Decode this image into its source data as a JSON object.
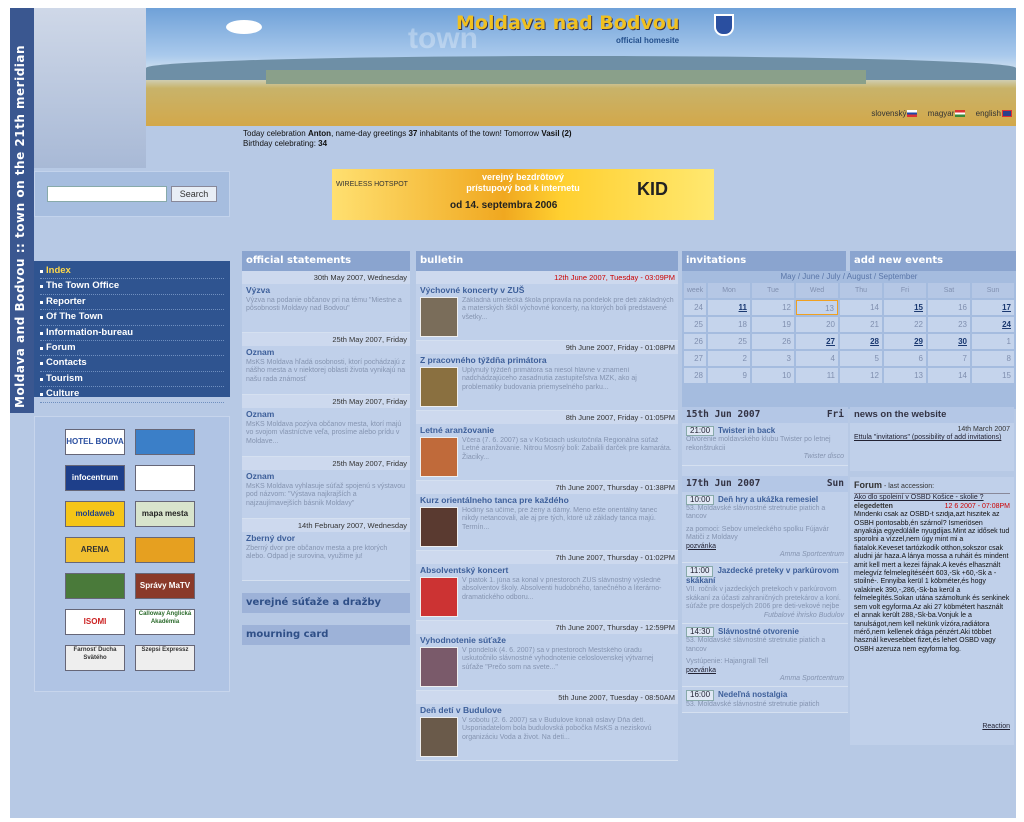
{
  "sidebar": {
    "vertical_title": "Moldava and Bodvou :: town on the 21th meridian",
    "search_button": "Search",
    "nav": [
      "Index",
      "The Town Office",
      "Reporter",
      "Of The Town",
      "Information-bureau",
      "Forum",
      "Contacts",
      "Tourism",
      "Culture"
    ]
  },
  "header": {
    "title": "Moldava nad Bodvou",
    "subtitle": "official homesite",
    "watermark": "town",
    "languages": [
      "slovenský",
      "magyar",
      "english"
    ]
  },
  "celebration": {
    "pre": "Today celebration",
    "name": "Anton",
    "mid": ", name-day greetings",
    "count": "37",
    "post": "inhabitants of the town! Tomorrow",
    "tomorrow": "Vasil (2)",
    "birthday_label": "Birthday celebrating:",
    "birthday_count": "34"
  },
  "ad": {
    "left": "WIRELESS HOTSPOT",
    "line1": "verejný bezdrôtový",
    "line2": "prístupový bod k internetu",
    "date": "od 14. septembra 2006",
    "brand": "KID"
  },
  "logos": [
    "HOTEL BODVA",
    "",
    "infocentrum",
    "",
    "moldaweb",
    "mapa mesta",
    "ARENA",
    "",
    "",
    "Správy MaTV",
    "ISOMI",
    "Calloway Anglická Akadémia",
    "Farnosť Ducha Svätého",
    "Szepsi Expressz"
  ],
  "statements": {
    "heading": "official statements",
    "items": [
      {
        "date": "30th May 2007, Wednesday",
        "title": "Výzva",
        "text": "Výzva na podanie občanov pri na tému \"Miestne a pôsobnosti Moldavy nad Bodvou\""
      },
      {
        "date": "25th May 2007, Friday",
        "title": "Oznam",
        "text": "MsKS Moldava hľadá osobnosti, ktorí pochádzajú z nášho mesta a v niektorej oblasti života vynikajú na našu rada známosť"
      },
      {
        "date": "25th May 2007, Friday",
        "title": "Oznam",
        "text": "MsKS Moldava pozýva občanov mesta, ktorí majú vo svojom vlastníctve veľa, prosíme alebo prídu v Moldave..."
      },
      {
        "date": "25th May 2007, Friday",
        "title": "Oznam",
        "text": "MsKS Moldava vyhlasuje súťaž spojenú s výstavou pod názvom: \"Výstava najkrajších a najzaujímavejších básnik Moldavy\""
      },
      {
        "date": "14th February 2007, Wednesday",
        "title": "Zberný dvor",
        "text": "Zberný dvor pre občanov mesta a pre ktorých alebo. Odpad je surovina, využime ju!"
      }
    ],
    "link1": "verejné súťaže a dražby",
    "link2": "mourning card"
  },
  "bulletin": {
    "heading": "bulletin",
    "items": [
      {
        "date": "12th June 2007, Tuesday - 03:09PM",
        "title": "Výchovné koncerty v ZUŠ",
        "text": "Základná umelecká škola pripravila na pondelok pre deti základných a materských škôl výchovné koncerty, na ktorých boli predstavené všetky..."
      },
      {
        "date": "9th June 2007, Friday - 01:08PM",
        "title": "Z pracovného týždňa primátora",
        "text": "Uplynulý týždeň primátora sa niesol hlavne v znamení nadchádzajúceho zasadnutia zastupiteľstva MZK, ako aj problematiky budovania priemyselného parku..."
      },
      {
        "date": "8th June 2007, Friday - 01:05PM",
        "title": "Letné aranžovanie",
        "text": "Včera (7. 6. 2007) sa v Košiciach uskutočnila Regionálna súťaž Letné aranžovanie. Nitrou Mosný boli: Zabalili darček pre kamaráta. Žiaciky..."
      },
      {
        "date": "7th June 2007, Thursday - 01:38PM",
        "title": "Kurz orientálneho tanca pre každého",
        "text": "Hodiny sa učíme, pre ženy a dámy. Meno ešte orientálny tanec nikdy netancovali, ale aj pre tých, ktoré už základy tanca majú. Termín..."
      },
      {
        "date": "7th June 2007, Thursday - 01:02PM",
        "title": "Absolventský koncert",
        "text": "V piatok 1. júna sa konal v priestoroch ZUŠ slávnostný výsledné absolventov školy. Absolventi hudobného, tanečného a literárno-dramatického odboru..."
      },
      {
        "date": "7th June 2007, Thursday - 12:59PM",
        "title": "Vyhodnotenie súťaže",
        "text": "V pondelok (4. 6. 2007) sa v priestoroch Mestského úradu uskutočnilo slávnostné vyhodnotenie celoslovenskej výtvarnej súťaže \"Prečo som na svete...\""
      },
      {
        "date": "5th June 2007, Tuesday - 08:50AM",
        "title": "Deň detí v Budulove",
        "text": "V sobotu (2. 6. 2007) sa v Budulove konali oslavy Dňa detí. Usporiadatelom bola budulovská pobočka MsKS a neziskovú organizáciu Voda a život. Na deti..."
      }
    ]
  },
  "invitations": {
    "heading": "invitations",
    "cal_nav": "May / June / July / August / September",
    "weekdays": [
      "week",
      "Mon",
      "Tue",
      "Wed",
      "Thu",
      "Fri",
      "Sat",
      "Sun"
    ],
    "weeks": [
      [
        "24",
        "11",
        "12",
        "13",
        "14",
        "15",
        "16",
        "17"
      ],
      [
        "25",
        "18",
        "19",
        "20",
        "21",
        "22",
        "23",
        "24"
      ],
      [
        "26",
        "25",
        "26",
        "27",
        "28",
        "29",
        "30",
        "1"
      ],
      [
        "27",
        "2",
        "3",
        "4",
        "5",
        "6",
        "7",
        "8"
      ],
      [
        "28",
        "9",
        "10",
        "11",
        "12",
        "13",
        "14",
        "15"
      ]
    ],
    "day1": {
      "date": "15th Jun 2007",
      "dow": "Fri",
      "time": "21:00",
      "title": "Twister in back",
      "text": "Otvorenie moldavského klubu Twister po letnej rekonštrukcii",
      "sig": "Twister disco"
    },
    "day2": {
      "date": "17th Jun 2007",
      "dow": "Sun",
      "events": [
        {
          "time": "10:00",
          "title": "Deň hry a ukážka remesiel",
          "text": "53. Moldavské slávnostné stretnutie piatich a tancov",
          "text2": "za pomoci: Sebov umeleckého spolku Fújavár Matiči z Moldavy",
          "link": "pozvánka",
          "sig": "Amma Sportcentrum"
        },
        {
          "time": "11:00",
          "title": "Jazdecké preteky v parkúrovom skákaní",
          "text": "VII. ročník v jazdeckých pretekoch v parkúrovom skákaní za účasti zahraničných pretekárov a koní.",
          "text2": "súťaže pre dospelých 2006 pre deti-vekové nejbe",
          "sig": "Futbalové ihrisko Budulov"
        },
        {
          "time": "14:30",
          "title": "Slávnostné otvorenie",
          "text": "53. Moldavské slávnostné stretnutie piatich a tancov",
          "text2": "Vystúpenie: Hajangrall Tell",
          "link": "pozvánka",
          "sig": "Amma Sportcentrum"
        },
        {
          "time": "16:00",
          "title": "Nedeľná nostalgia",
          "text": "53. Moldavské slávnostné stretnutie piatich"
        }
      ]
    }
  },
  "add_events": {
    "heading": "add new events"
  },
  "news": {
    "heading": "news on the website",
    "date": "14th March 2007",
    "link": "Ettula \"invitations\" (possibility of add invitations)"
  },
  "forum": {
    "heading": "Forum",
    "sub": " - last accession:",
    "topic": "Ako dlo spoleiní v OSBD Košice - skolie ?",
    "user": "elegedetten",
    "time": "12 6 2007 - 07:08PM",
    "body": "Mindenki csak az OSBD-t szidja,azt hiszitek az OSBH pontosabb,én szárnol? Ismeriösen anyakája egyedülálle nyugdijas.Mint az idősek tud sporolni a vízzel,nem úgy mint mi a fiatalok.Keveset tartózkodik otthon,sokszor csak aludni jár haza.A lánya mossa a ruháit és mindent amit kell mert a kezei fájnak.A kevés elhasznált melegvíz felmelegítéséért 603,-Sk +60,-Sk a -stoilné-. Ennyiba kerül 1 köbméter,és hogy valakinek 390,-,286,-Sk-ba kerül a felmelegítés.Sokan utána számoltunk és senkinek sem volt egyforma.Az aki 27 köbmétert használt el annak került 288,-Sk-ba.Vonjuk le a tanulságot,nem kell nekünk vízóra,radiátora mérő,nem kellenek drága pénzért.Aki többet használ kevesebbet fizet,és lehet OSBD vagy OSBH azeruza nem egyforma fog.",
    "reaction": "Reaction"
  },
  "colors": {
    "page_bg": "#b7c9e5",
    "nav_bg": "#2f5490",
    "head_bg": "#8aa4cf",
    "accent": "#ffd84a",
    "date_red": "#cc0000"
  }
}
